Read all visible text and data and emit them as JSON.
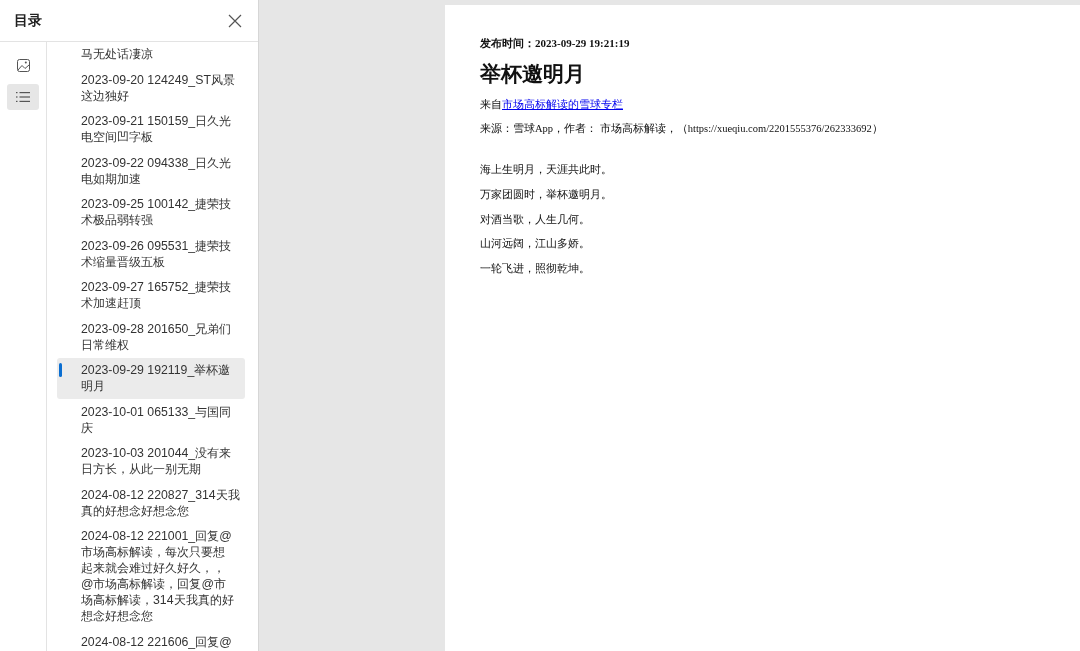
{
  "panel": {
    "title": "目录",
    "tools": [
      {
        "kind": "image",
        "selected": false
      },
      {
        "kind": "list",
        "selected": true
      }
    ]
  },
  "toc": [
    {
      "lines": [
        "马无处话凄凉"
      ],
      "selected": false
    },
    {
      "lines": [
        "2023-09-20 124249_ST风景",
        "这边独好"
      ],
      "selected": false
    },
    {
      "lines": [
        "2023-09-21 150159_日久光",
        "电空间凹字板"
      ],
      "selected": false
    },
    {
      "lines": [
        "2023-09-22 094338_日久光",
        "电如期加速"
      ],
      "selected": false
    },
    {
      "lines": [
        "2023-09-25 100142_捷荣技",
        "术极品弱转强"
      ],
      "selected": false
    },
    {
      "lines": [
        "2023-09-26 095531_捷荣技",
        "术缩量晋级五板"
      ],
      "selected": false
    },
    {
      "lines": [
        "2023-09-27 165752_捷荣技",
        "术加速赶顶"
      ],
      "selected": false
    },
    {
      "lines": [
        "2023-09-28 201650_兄弟们",
        "日常维权"
      ],
      "selected": false
    },
    {
      "lines": [
        "2023-09-29 192119_举杯邀",
        "明月"
      ],
      "selected": true
    },
    {
      "lines": [
        "2023-10-01 065133_与国同",
        "庆"
      ],
      "selected": false
    },
    {
      "lines": [
        "2023-10-03 201044_没有来",
        "日方长，从此一别无期"
      ],
      "selected": false
    },
    {
      "lines": [
        "2024-08-12 220827_314天我",
        "真的好想念好想念您"
      ],
      "selected": false
    },
    {
      "lines": [
        "2024-08-12 221001_回复@",
        "市场高标解读，每次只要想",
        "起来就会难过好久好久，，",
        "@市场高标解读，回复@市",
        "场高标解读，314天我真的好",
        "想念好想念您"
      ],
      "selected": false
    },
    {
      "lines": [
        "2024-08-12 221606_回复@"
      ],
      "selected": false
    }
  ],
  "document": {
    "publish_time": "发布时间：2023-09-29 19:21:19",
    "title": "举杯邀明月",
    "from_prefix": "来自",
    "from_link": "市场高标解读的雪球专栏",
    "source": "来源：雪球App，作者： 市场高标解读，（https://xueqiu.com/2201555376/262333692）",
    "paragraphs": [
      "海上生明月，天涯共此时。",
      "万家团圆时，举杯邀明月。",
      "对酒当歌，人生几何。",
      "山河远阔，江山多娇。",
      "一轮飞进，照彻乾坤。"
    ]
  }
}
